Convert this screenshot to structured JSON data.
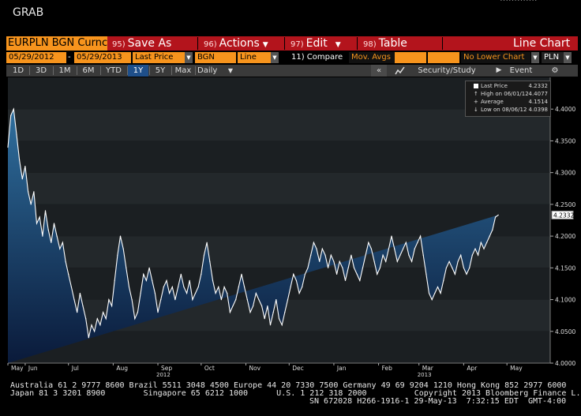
{
  "app": {
    "title": "GRAB"
  },
  "toolbar": {
    "ticker": "EURPLN BGN Curnc",
    "save": {
      "num": "95)",
      "label": "Save As"
    },
    "actions": {
      "num": "96)",
      "label": "Actions"
    },
    "edit": {
      "num": "97)",
      "label": "Edit"
    },
    "table": {
      "num": "98)",
      "label": "Table"
    },
    "chart_type": "Line Chart"
  },
  "params": {
    "start_date": "05/29/2012",
    "dash": "-",
    "end_date": "05/29/2013",
    "price_field": "Last Price",
    "source": "BGN",
    "style": "Line",
    "compare": "11) Compare",
    "mov_avgs": "Mov. Avgs",
    "lower_chart": "No Lower Chart",
    "currency": "PLN"
  },
  "ranges": {
    "items": [
      "1D",
      "3D",
      "1M",
      "6M",
      "YTD",
      "1Y",
      "5Y",
      "Max"
    ],
    "active": "1Y",
    "period": "Daily",
    "back": "«",
    "security_study": "Security/Study",
    "event": "Event"
  },
  "legend": {
    "last_label": "Last Price",
    "last_value": "4.2332",
    "high_label": "High on 06/01/12",
    "high_value": "4.4077",
    "avg_label": "Average",
    "avg_value": "4.1514",
    "low_label": "Low on 08/06/12",
    "low_value": "4.0398"
  },
  "colors": {
    "fill_top": "#2f6f9e",
    "fill_bottom": "#0a1a3a",
    "line": "#ffffff",
    "accent_orange": "#f7941d",
    "command_red": "#b3141c"
  },
  "chart_data": {
    "type": "area",
    "title": "",
    "xlabel": "",
    "ylabel": "",
    "ylim": [
      4.0,
      4.45
    ],
    "ytick_labels": [
      "4.4000",
      "4.3500",
      "4.3000",
      "4.2500",
      "4.2000",
      "4.1500",
      "4.1000",
      "4.0500",
      "4.0000"
    ],
    "yticks": [
      4.4,
      4.35,
      4.3,
      4.25,
      4.2,
      4.15,
      4.1,
      4.05,
      4.0
    ],
    "xtick_labels": [
      "May",
      "Jun",
      "Jul",
      "Aug",
      "Sep",
      "Oct",
      "Nov",
      "Dec",
      "Jan",
      "Feb",
      "Mar",
      "Apr",
      "May"
    ],
    "xtick_days": [
      0,
      12,
      42,
      73,
      104,
      134,
      165,
      195,
      226,
      257,
      285,
      316,
      346
    ],
    "year_labels": [
      {
        "label": "2012",
        "day": 104
      },
      {
        "label": "2013",
        "day": 285
      }
    ],
    "x_start": "2012-05-01",
    "x_span_days": 376,
    "last_value_label": "4.2332",
    "series": [
      {
        "name": "Last Price",
        "days": [
          0,
          2,
          4,
          6,
          8,
          10,
          12,
          14,
          16,
          18,
          20,
          22,
          24,
          26,
          28,
          30,
          32,
          34,
          36,
          38,
          40,
          42,
          44,
          46,
          48,
          50,
          52,
          54,
          56,
          58,
          60,
          62,
          64,
          66,
          68,
          70,
          72,
          74,
          76,
          78,
          80,
          82,
          84,
          86,
          88,
          90,
          92,
          94,
          96,
          98,
          100,
          102,
          104,
          106,
          108,
          110,
          112,
          114,
          116,
          118,
          120,
          122,
          124,
          126,
          128,
          130,
          132,
          134,
          136,
          138,
          140,
          142,
          144,
          146,
          148,
          150,
          152,
          154,
          156,
          158,
          160,
          162,
          164,
          166,
          168,
          170,
          172,
          174,
          176,
          178,
          180,
          182,
          184,
          186,
          188,
          190,
          192,
          194,
          196,
          198,
          200,
          202,
          204,
          206,
          208,
          210,
          212,
          214,
          216,
          218,
          220,
          222,
          224,
          226,
          228,
          230,
          232,
          234,
          236,
          238,
          240,
          242,
          244,
          246,
          248,
          250,
          252,
          254,
          256,
          258,
          260,
          262,
          264,
          266,
          268,
          270,
          272,
          274,
          276,
          278,
          280,
          282,
          284,
          286,
          288,
          290,
          292,
          294,
          296,
          298,
          300,
          302,
          304,
          306,
          308,
          310,
          312,
          314,
          316,
          318,
          320,
          322,
          324,
          326,
          328,
          330,
          332,
          334,
          336,
          338,
          340,
          342,
          344,
          346,
          348,
          350,
          352,
          354,
          356,
          358,
          360,
          362,
          364,
          366
        ],
        "values": [
          4.34,
          4.39,
          4.4,
          4.36,
          4.32,
          4.29,
          4.31,
          4.27,
          4.25,
          4.27,
          4.22,
          4.23,
          4.2,
          4.24,
          4.21,
          4.19,
          4.22,
          4.2,
          4.18,
          4.19,
          4.16,
          4.14,
          4.12,
          4.1,
          4.08,
          4.11,
          4.09,
          4.07,
          4.04,
          4.06,
          4.05,
          4.07,
          4.06,
          4.08,
          4.07,
          4.1,
          4.09,
          4.13,
          4.17,
          4.2,
          4.18,
          4.15,
          4.12,
          4.1,
          4.07,
          4.08,
          4.11,
          4.14,
          4.13,
          4.15,
          4.13,
          4.11,
          4.08,
          4.1,
          4.12,
          4.13,
          4.11,
          4.12,
          4.1,
          4.12,
          4.14,
          4.12,
          4.11,
          4.13,
          4.1,
          4.11,
          4.12,
          4.14,
          4.17,
          4.19,
          4.16,
          4.13,
          4.11,
          4.12,
          4.1,
          4.12,
          4.11,
          4.08,
          4.09,
          4.1,
          4.12,
          4.14,
          4.12,
          4.1,
          4.08,
          4.09,
          4.11,
          4.1,
          4.09,
          4.07,
          4.09,
          4.06,
          4.08,
          4.1,
          4.07,
          4.06,
          4.08,
          4.1,
          4.12,
          4.14,
          4.13,
          4.11,
          4.12,
          4.14,
          4.15,
          4.17,
          4.19,
          4.18,
          4.16,
          4.18,
          4.17,
          4.15,
          4.17,
          4.16,
          4.14,
          4.16,
          4.15,
          4.13,
          4.15,
          4.17,
          4.15,
          4.14,
          4.13,
          4.15,
          4.17,
          4.19,
          4.18,
          4.16,
          4.14,
          4.15,
          4.17,
          4.16,
          4.18,
          4.2,
          4.18,
          4.16,
          4.17,
          4.18,
          4.19,
          4.17,
          4.16,
          4.18,
          4.19,
          4.2,
          4.17,
          4.14,
          4.11,
          4.1,
          4.11,
          4.12,
          4.11,
          4.13,
          4.15,
          4.16,
          4.15,
          4.14,
          4.16,
          4.17,
          4.15,
          4.14,
          4.15,
          4.17,
          4.18,
          4.17,
          4.19,
          4.18,
          4.19,
          4.2,
          4.21,
          4.23,
          4.2332
        ]
      }
    ]
  },
  "footer": {
    "line1": "Australia 61 2 9777 8600 Brazil 5511 3048 4500 Europe 44 20 7330 7500 Germany 49 69 9204 1210 Hong Kong 852 2977 6000",
    "line2": "Japan 81 3 3201 8900        Singapore 65 6212 1000      U.S. 1 212 318 2000          Copyright 2013 Bloomberg Finance L.P.",
    "line3": "SN 672028 H266-1916-1 29-May-13  7:32:15 EDT  GMT-4:00"
  }
}
